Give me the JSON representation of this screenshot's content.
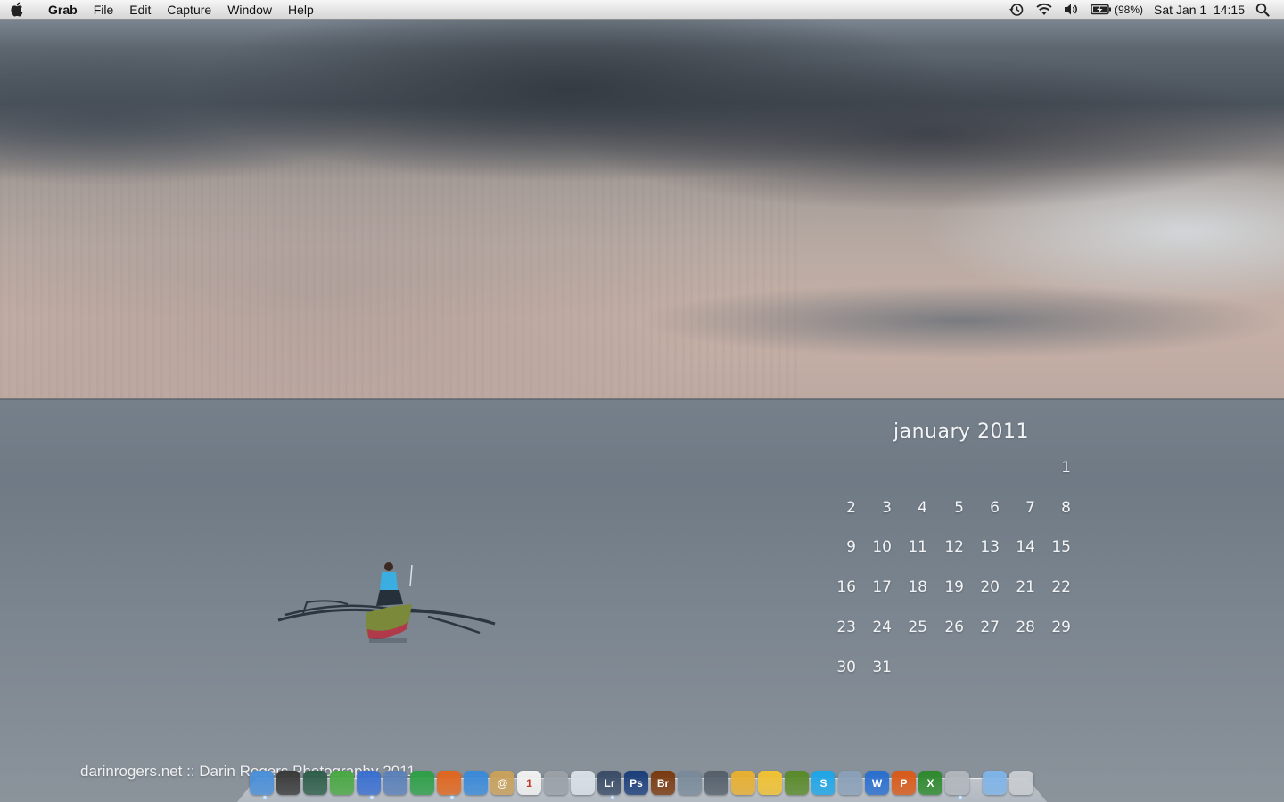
{
  "menubar": {
    "apple_icon": "apple-icon",
    "app_name": "Grab",
    "menus": [
      "File",
      "Edit",
      "Capture",
      "Window",
      "Help"
    ],
    "status": {
      "time_machine_icon": "time-machine-icon",
      "wifi_icon": "wifi-icon",
      "volume_icon": "volume-icon",
      "battery_icon": "battery-charging-icon",
      "battery_percent": "(98%)",
      "datetime": "Sat Jan 1  14:15",
      "spotlight_icon": "spotlight-search-icon"
    }
  },
  "calendar": {
    "title": "january 2011",
    "weeks": [
      [
        "",
        "",
        "",
        "",
        "",
        "",
        "1"
      ],
      [
        "2",
        "3",
        "4",
        "5",
        "6",
        "7",
        "8"
      ],
      [
        "9",
        "10",
        "11",
        "12",
        "13",
        "14",
        "15"
      ],
      [
        "16",
        "17",
        "18",
        "19",
        "20",
        "21",
        "22"
      ],
      [
        "23",
        "24",
        "25",
        "26",
        "27",
        "28",
        "29"
      ],
      [
        "30",
        "31",
        "",
        "",
        "",
        "",
        ""
      ]
    ]
  },
  "credit": "darinrogers.net :: Darin Rogers Photography 2011",
  "dock": {
    "apps": [
      {
        "name": "finder-icon",
        "label": "",
        "color": "#4a8fd8"
      },
      {
        "name": "dashboard-icon",
        "label": "",
        "color": "#3a3a3a"
      },
      {
        "name": "time-machine-app-icon",
        "label": "",
        "color": "#2f5e4a"
      },
      {
        "name": "adium-icon",
        "label": "",
        "color": "#4aa843"
      },
      {
        "name": "itunes-icon",
        "label": "",
        "color": "#3b6fd0"
      },
      {
        "name": "mail-stamp-icon",
        "label": "",
        "color": "#5b80b8"
      },
      {
        "name": "chrome-icon",
        "label": "",
        "color": "#2e9f48"
      },
      {
        "name": "firefox-icon",
        "label": "",
        "color": "#e0661e"
      },
      {
        "name": "safari-icon",
        "label": "",
        "color": "#3a8ad8"
      },
      {
        "name": "address-book-icon",
        "label": "@",
        "color": "#c9a15a"
      },
      {
        "name": "ical-icon",
        "label": "1",
        "color": "#f2f2f2"
      },
      {
        "name": "calculator-icon",
        "label": "",
        "color": "#9aa0a6"
      },
      {
        "name": "preview-icon",
        "label": "",
        "color": "#d9dfe6"
      },
      {
        "name": "lightroom-icon",
        "label": "Lr",
        "color": "#3a4c66"
      },
      {
        "name": "photoshop-icon",
        "label": "Ps",
        "color": "#1c3f7a"
      },
      {
        "name": "bridge-icon",
        "label": "Br",
        "color": "#7a3a10"
      },
      {
        "name": "iphoto-icon",
        "label": "",
        "color": "#7a8a9a"
      },
      {
        "name": "imovie-star-icon",
        "label": "",
        "color": "#55606b"
      },
      {
        "name": "transmit-truck-icon",
        "label": "",
        "color": "#e8b030"
      },
      {
        "name": "cyberduck-icon",
        "label": "",
        "color": "#f1c232"
      },
      {
        "name": "growl-pineapple-icon",
        "label": "",
        "color": "#5a8a2a"
      },
      {
        "name": "skype-icon",
        "label": "S",
        "color": "#1fa6e8"
      },
      {
        "name": "automator-icon",
        "label": "",
        "color": "#8aa0b8"
      },
      {
        "name": "word-icon",
        "label": "W",
        "color": "#2a6fd0"
      },
      {
        "name": "powerpoint-icon",
        "label": "P",
        "color": "#d95a1a"
      },
      {
        "name": "excel-icon",
        "label": "X",
        "color": "#2e8a2e"
      },
      {
        "name": "system-preferences-icon",
        "label": "",
        "color": "#b0b6bc"
      }
    ],
    "stacks": [
      {
        "name": "documents-folder-icon",
        "label": "",
        "color": "#7fb4e8"
      },
      {
        "name": "trash-icon",
        "label": "",
        "color": "#c8ccd0"
      }
    ]
  }
}
